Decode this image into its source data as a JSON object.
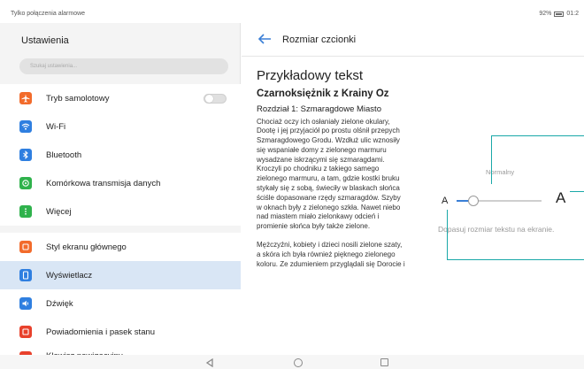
{
  "status": {
    "carrier": "Tylko połączenia alarmowe",
    "battery": "92%",
    "time": "01:2"
  },
  "settings": {
    "title": "Ustawienia",
    "search_placeholder": "Szukaj ustawienia...",
    "items": [
      {
        "label": "Tryb samolotowy",
        "icon": "airplane-icon",
        "color": "#f26b2b"
      },
      {
        "label": "Wi-Fi",
        "icon": "wifi-icon",
        "color": "#2f7fe0"
      },
      {
        "label": "Bluetooth",
        "icon": "bluetooth-icon",
        "color": "#2f7fe0"
      },
      {
        "label": "Komórkowa transmisja danych",
        "icon": "mobile-data-icon",
        "color": "#2fb24c"
      },
      {
        "label": "Więcej",
        "icon": "more-icon",
        "color": "#2fb24c"
      },
      {
        "label": "Styl ekranu głównego",
        "icon": "home-style-icon",
        "color": "#f26b2b"
      },
      {
        "label": "Wyświetlacz",
        "icon": "display-icon",
        "color": "#2f7fe0"
      },
      {
        "label": "Dźwięk",
        "icon": "sound-icon",
        "color": "#2f7fe0"
      },
      {
        "label": "Powiadomienia i pasek stanu",
        "icon": "notifications-icon",
        "color": "#e8412c"
      },
      {
        "label": "Klawisz nawigacyjny",
        "icon": "nav-key-icon",
        "color": "#e8412c"
      }
    ]
  },
  "font_size": {
    "header_title": "Rozmiar czcionki",
    "sample_title": "Przykładowy tekst",
    "book_title": "Czarnoksiężnik z Krainy Oz",
    "chapter": "Rozdział 1: Szmaragdowe Miasto",
    "paragraph1": "Chociaż oczy ich osłaniały zielone okulary, Dootę i jej przyjaciół po prostu olśnił przepych Szmaragdowego Grodu. Wzdłuż ulic wznosiły się wspaniałe domy z zielonego marmuru wysadzane iskrzącymi się szmaragdami. Kroczyli po chodniku z takiego samego zielonego marmuru, a tam, gdzie kostki bruku stykały się z sobą, świeciły w blaskach słońca ściśle dopasowane rzędy szmaragdów. Szyby w oknach były z zielonego szkła. Nawet niebo nad miastem miało zielonkawy odcień i promienie słońca były także zielone.",
    "paragraph2": "Mężczyźni, kobiety i dzieci nosili zielone szaty, a skóra ich była również pięknego zielonego koloru. Ze zdumieniem przyglądali się Dorocie i",
    "size_label": "Normalny",
    "small_a": "A",
    "large_a": "A",
    "slider_fraction": 0.2,
    "hint": "Dopasuj rozmiar tekstu na ekranie."
  }
}
